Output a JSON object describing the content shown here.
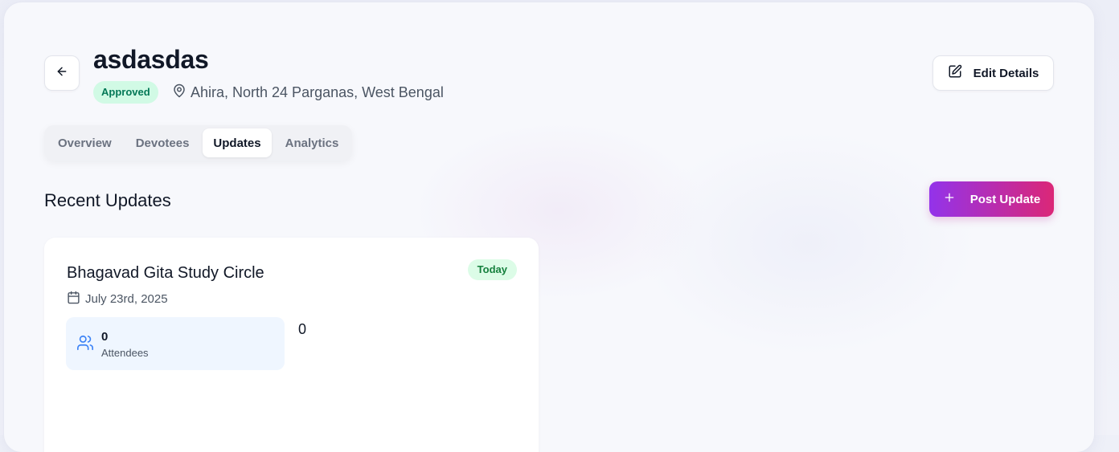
{
  "header": {
    "title": "asdasdas",
    "status_badge": "Approved",
    "location": "Ahira, North 24 Parganas, West Bengal",
    "edit_button": "Edit Details"
  },
  "tabs": [
    {
      "label": "Overview",
      "active": false
    },
    {
      "label": "Devotees",
      "active": false
    },
    {
      "label": "Updates",
      "active": true
    },
    {
      "label": "Analytics",
      "active": false
    }
  ],
  "section": {
    "title": "Recent Updates",
    "post_button": "Post Update"
  },
  "updates": [
    {
      "title": "Bhagavad Gita Study Circle",
      "badge": "Today",
      "date": "July 23rd, 2025",
      "attendees_value": "0",
      "attendees_label": "Attendees",
      "extra_value": "0"
    }
  ],
  "colors": {
    "accent_start": "#9333ea",
    "accent_end": "#db2777",
    "approved_bg": "#d1fae5",
    "today_bg": "#dcfce7",
    "stat_bg": "#eff6ff"
  },
  "icons": [
    "arrow-left-icon",
    "map-pin-icon",
    "edit-icon",
    "plus-icon",
    "calendar-icon",
    "users-icon"
  ]
}
